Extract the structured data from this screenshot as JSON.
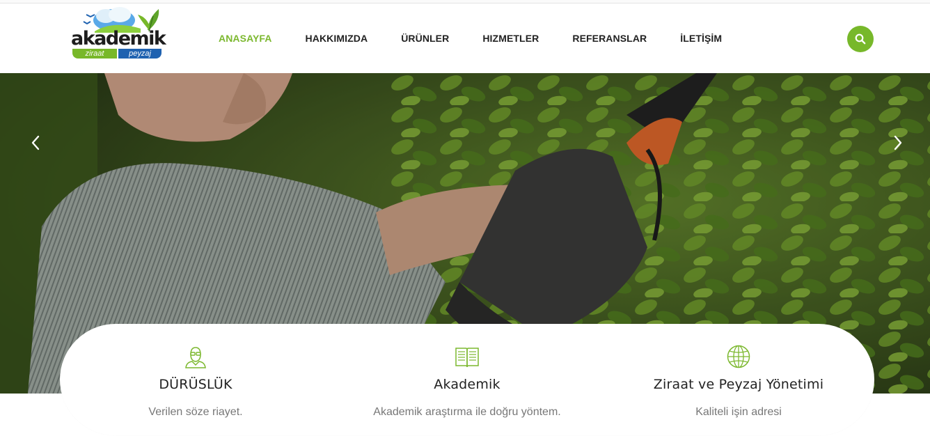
{
  "brand": {
    "logo_word": "akademik",
    "logo_tag_left": "ziraat",
    "logo_tag_right": "peyzaj"
  },
  "nav": {
    "items": [
      {
        "label": "ANASAYFA",
        "active": true
      },
      {
        "label": "HAKKIMIZDA",
        "active": false
      },
      {
        "label": "ÜRÜNLER",
        "active": false
      },
      {
        "label": "HIZMETLER",
        "active": false
      },
      {
        "label": "REFERANSLAR",
        "active": false
      },
      {
        "label": "İLETİŞİM",
        "active": false
      }
    ]
  },
  "search": {
    "icon": "search-icon"
  },
  "slider": {
    "prev_icon": "chevron-left-icon",
    "next_icon": "chevron-right-icon",
    "image": "gardener-pruning-hedge"
  },
  "features": [
    {
      "icon": "person-glasses-icon",
      "title": "DÜRÜSLÜK",
      "desc": "Verilen söze riayet."
    },
    {
      "icon": "open-book-icon",
      "title": "Akademik",
      "desc": "Akademik araştırma ile doğru yöntem."
    },
    {
      "icon": "globe-icon",
      "title": "Ziraat ve Peyzaj Yönetimi",
      "desc": "Kaliteli işin adresi"
    }
  ],
  "colors": {
    "accent": "#7cb82f",
    "brand_blue": "#1f62b0",
    "text": "#222222",
    "muted": "#777777"
  }
}
